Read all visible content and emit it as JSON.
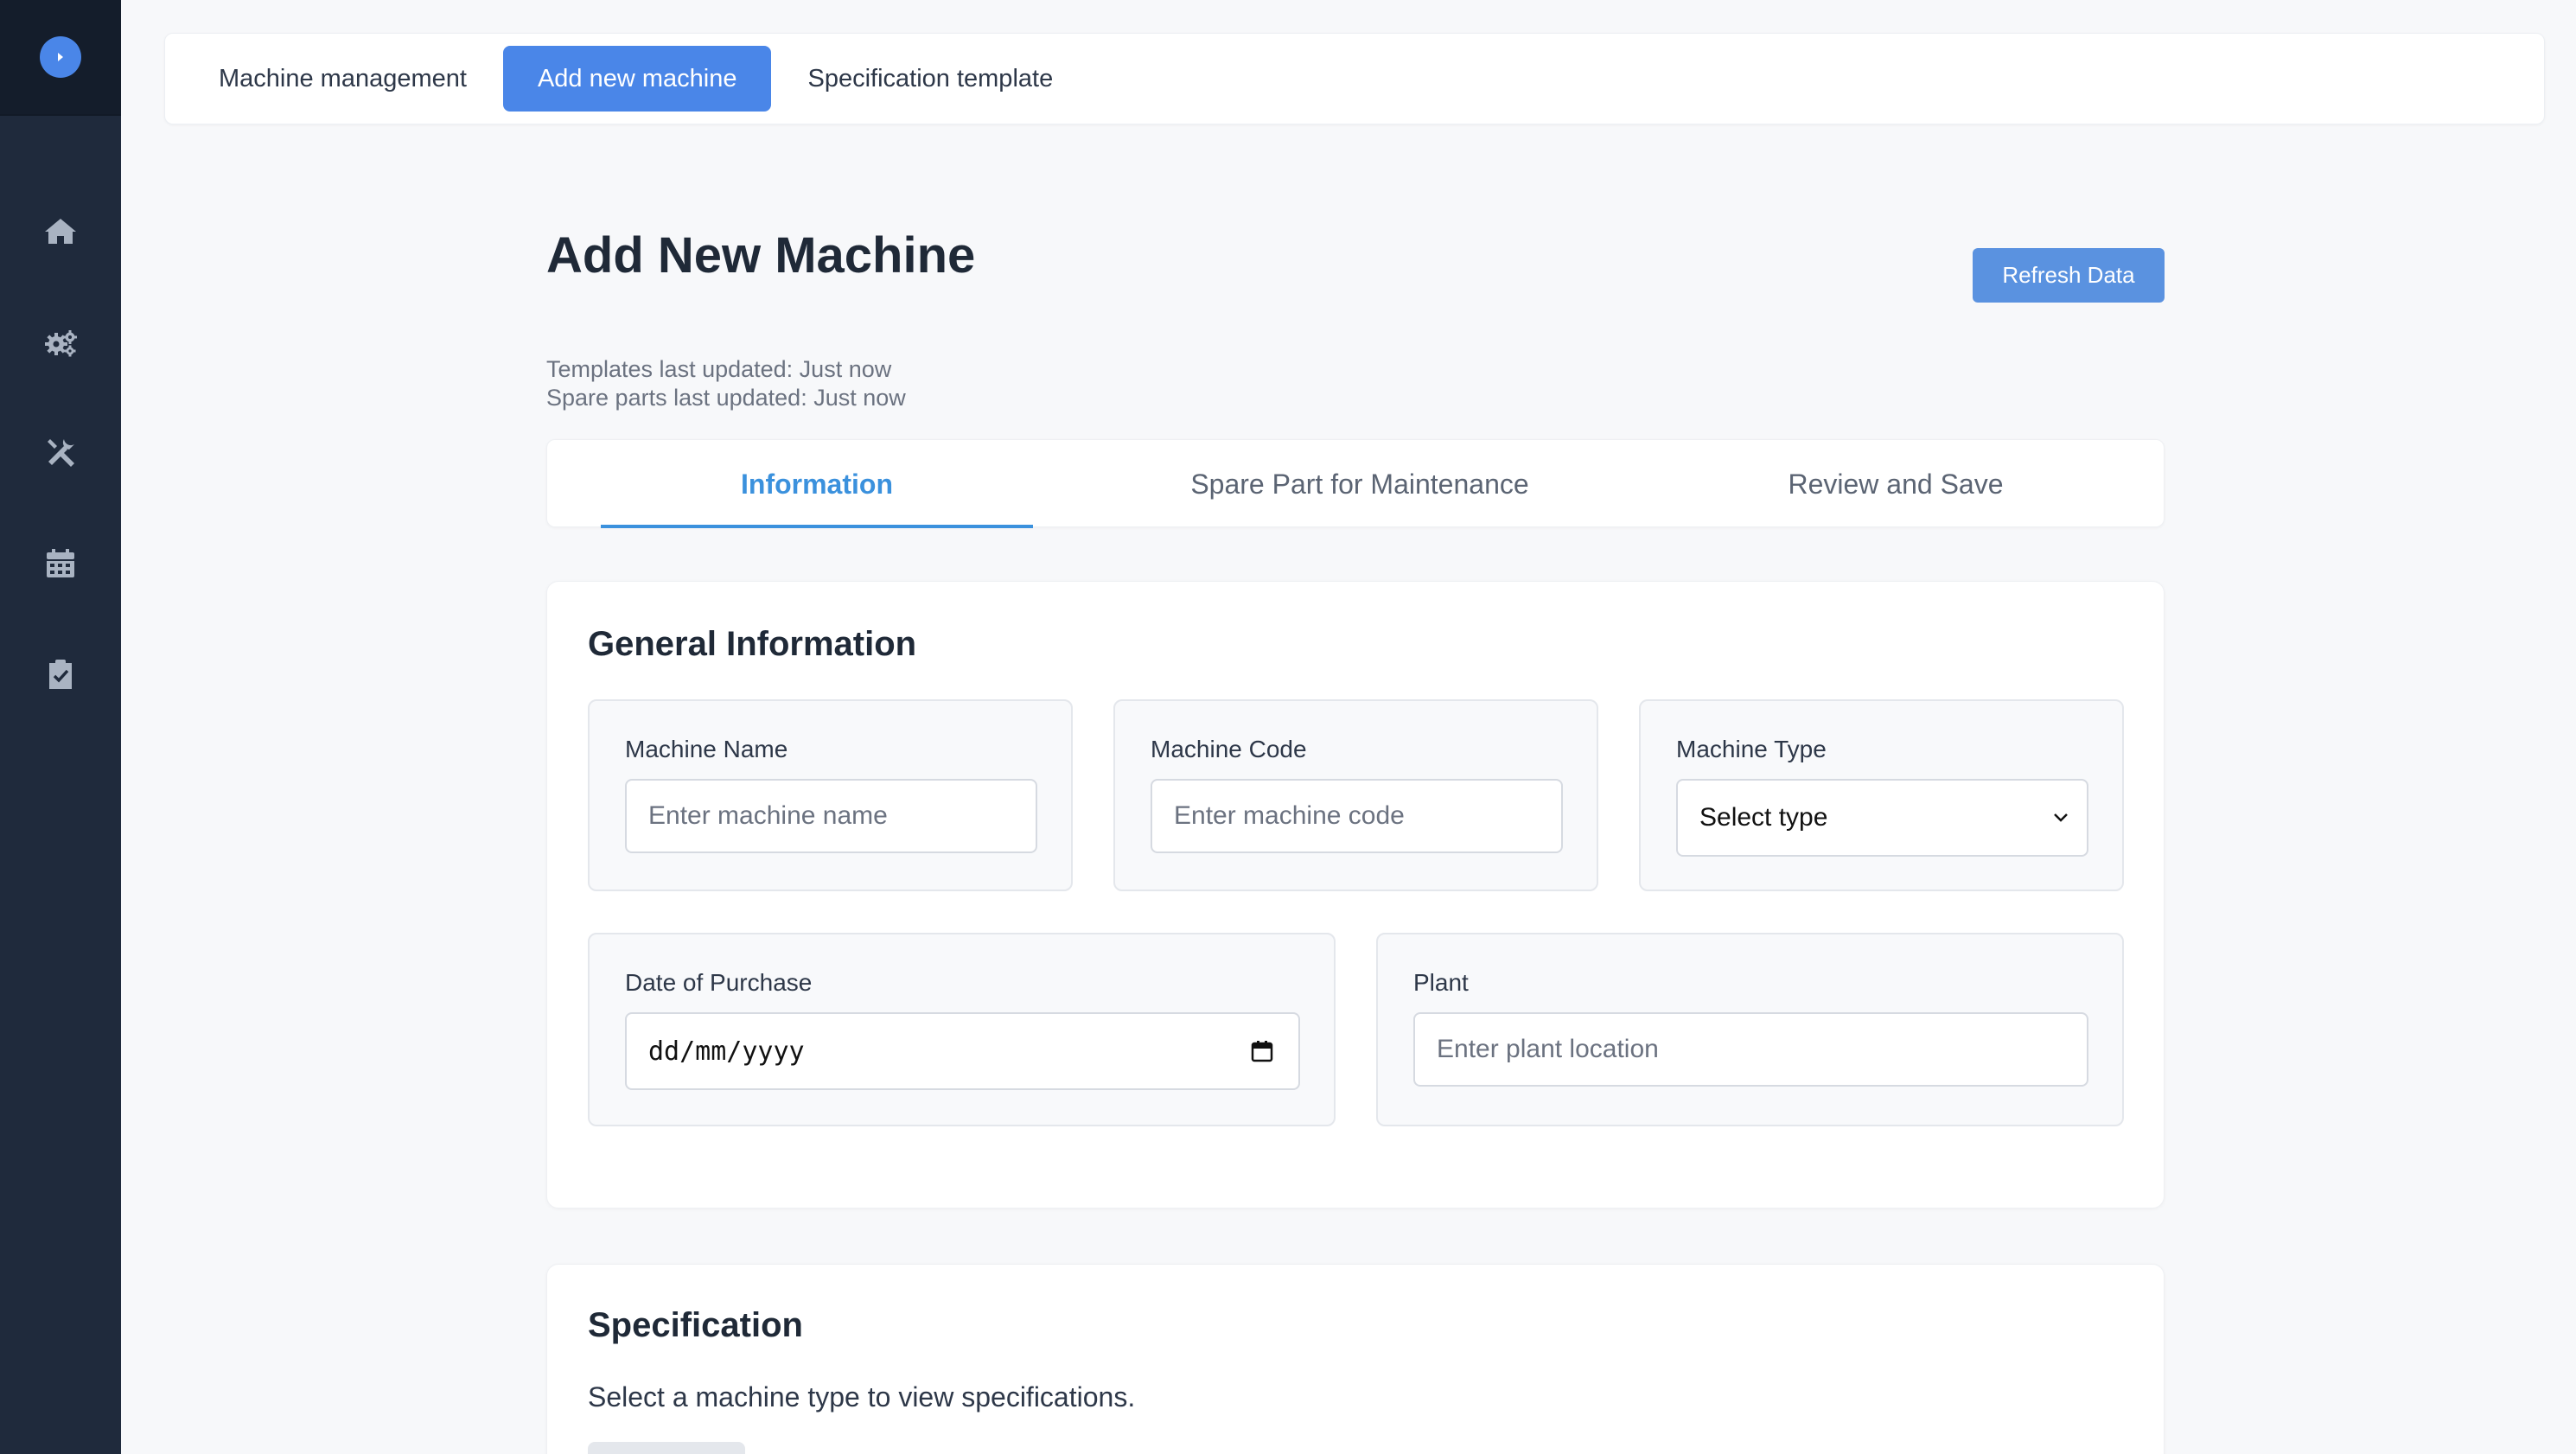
{
  "topnav": {
    "items": [
      {
        "label": "Machine management"
      },
      {
        "label": "Add new machine"
      },
      {
        "label": "Specification template"
      }
    ]
  },
  "header": {
    "title": "Add New Machine",
    "refresh_label": "Refresh Data",
    "templates_updated": "Templates last updated: Just now",
    "spare_parts_updated": "Spare parts last updated: Just now"
  },
  "tabs": [
    {
      "label": "Information"
    },
    {
      "label": "Spare Part for Maintenance"
    },
    {
      "label": "Review and Save"
    }
  ],
  "general": {
    "title": "General Information",
    "machine_name": {
      "label": "Machine Name",
      "placeholder": "Enter machine name"
    },
    "machine_code": {
      "label": "Machine Code",
      "placeholder": "Enter machine code"
    },
    "machine_type": {
      "label": "Machine Type",
      "value": "Select type"
    },
    "date_of_purchase": {
      "label": "Date of Purchase",
      "value": "dd/mm/yyyy"
    },
    "plant": {
      "label": "Plant",
      "placeholder": "Enter plant location"
    }
  },
  "specification": {
    "title": "Specification",
    "message": "Select a machine type to view specifications."
  },
  "sidebar": {
    "icons": [
      "home-icon",
      "gears-icon",
      "tools-icon",
      "calendar-icon",
      "clipboard-check-icon"
    ]
  },
  "colors": {
    "accent": "#4a86e8",
    "tab_active": "#3b91dd",
    "sidebar": "#1f2a3c"
  }
}
